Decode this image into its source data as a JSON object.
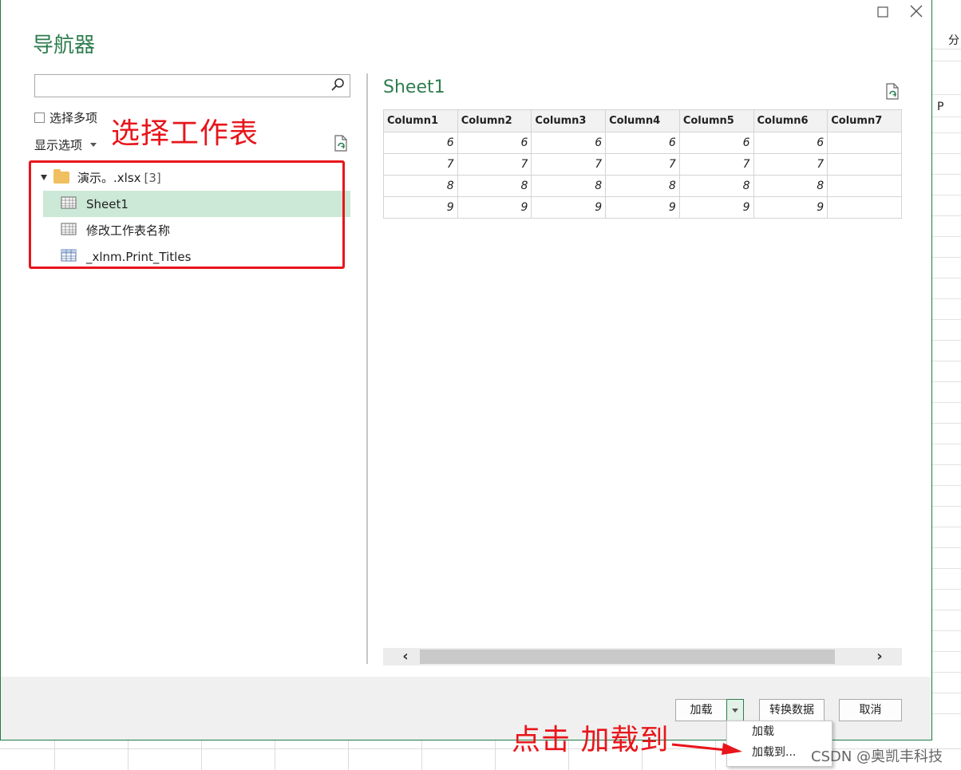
{
  "dialog": {
    "title": "导航器",
    "search": {
      "placeholder": "",
      "value": ""
    },
    "select_multiple": "选择多项",
    "display_options": "显示选项"
  },
  "tree": {
    "root": {
      "label": "演示。.xlsx",
      "count": "[3]"
    },
    "items": [
      {
        "label": "Sheet1",
        "icon": "sheet-icon",
        "selected": true
      },
      {
        "label": "修改工作表名称",
        "icon": "sheet-icon",
        "selected": false
      },
      {
        "label": "_xlnm.Print_Titles",
        "icon": "named-range-icon",
        "selected": false
      }
    ]
  },
  "preview": {
    "title": "Sheet1",
    "columns": [
      "Column1",
      "Column2",
      "Column3",
      "Column4",
      "Column5",
      "Column6",
      "Column7"
    ],
    "rows": [
      [
        "6",
        "6",
        "6",
        "6",
        "6",
        "6",
        ""
      ],
      [
        "7",
        "7",
        "7",
        "7",
        "7",
        "7",
        ""
      ],
      [
        "8",
        "8",
        "8",
        "8",
        "8",
        "8",
        ""
      ],
      [
        "9",
        "9",
        "9",
        "9",
        "9",
        "9",
        ""
      ]
    ]
  },
  "footer": {
    "load": "加载",
    "transform": "转换数据",
    "cancel": "取消"
  },
  "load_menu": {
    "items": [
      "加载",
      "加载到..."
    ]
  },
  "annotations": {
    "select_sheet": "选择工作表",
    "click_load_to": "点击 加载到"
  },
  "background": {
    "cell_fen": "分",
    "cell_p": "P"
  },
  "watermark": "CSDN @奥凯丰科技",
  "colors": {
    "accent": "#2e7d4f",
    "annotation": "#e8151b",
    "selection": "#cce8d6"
  }
}
